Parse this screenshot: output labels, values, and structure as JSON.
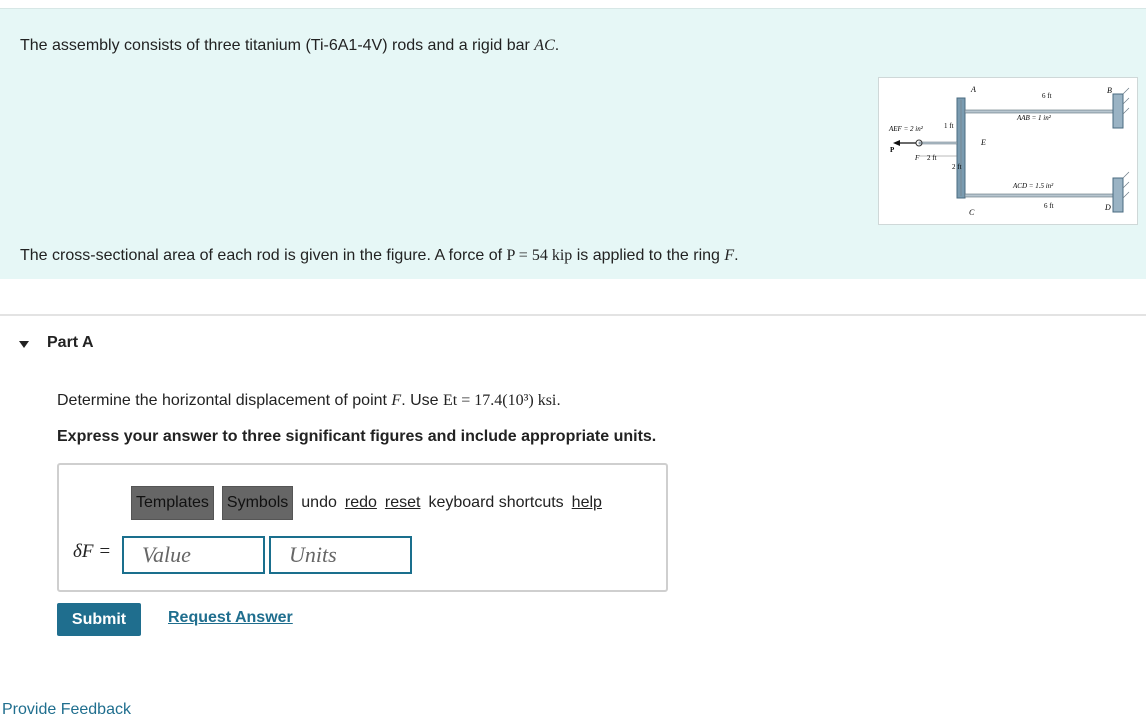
{
  "intro": {
    "line1": "The assembly consists of three titanium (Ti-6A1-4V) rods and a rigid bar",
    "line1_var": "AC",
    "line1_end": ".",
    "line2_a": "The cross-sectional area of each rod is given in the figure. A force of",
    "line2_eq": "P = 54 kip",
    "line2_b": "is applied to the ring",
    "line2_var": "F",
    "line2_end": "."
  },
  "figure": {
    "label_A": "A",
    "label_B": "B",
    "label_C": "C",
    "label_D": "D",
    "label_E": "E",
    "label_P": "P",
    "label_F": "F",
    "top_len": "6 ft",
    "bottom_len": "6 ft",
    "aab": "Aₐ₂ = 1 in²",
    "aab_text": "AAB = 1 in²",
    "acd_text": "ACD = 1.5 in²",
    "aef_text": "AEF = 2 in²",
    "dim_1ft": "1 ft",
    "dim_2ft_h": "2 ft",
    "dim_2ft_v": "2 ft"
  },
  "partA": {
    "title": "Part A",
    "question_a": "Determine the horizontal displacement of point",
    "question_var": "F",
    "question_b": ". Use",
    "question_eq": "Et = 17.4(10³) ksi",
    "question_end": ".",
    "instruction": "Express your answer to three significant figures and include appropriate units."
  },
  "toolbar": {
    "templates": "Templates",
    "symbols": "Symbols",
    "undo": "undo",
    "redo": "redo",
    "reset": "reset",
    "keyboard_shortcuts": "keyboard shortcuts",
    "help": "help"
  },
  "answer": {
    "variable": "δF =",
    "value_placeholder": "Value",
    "units_placeholder": "Units"
  },
  "actions": {
    "submit": "Submit",
    "request_answer": "Request Answer",
    "feedback": "Provide Feedback"
  },
  "colors": {
    "intro_bg": "#e6f7f6",
    "accent": "#1f6e8e"
  }
}
